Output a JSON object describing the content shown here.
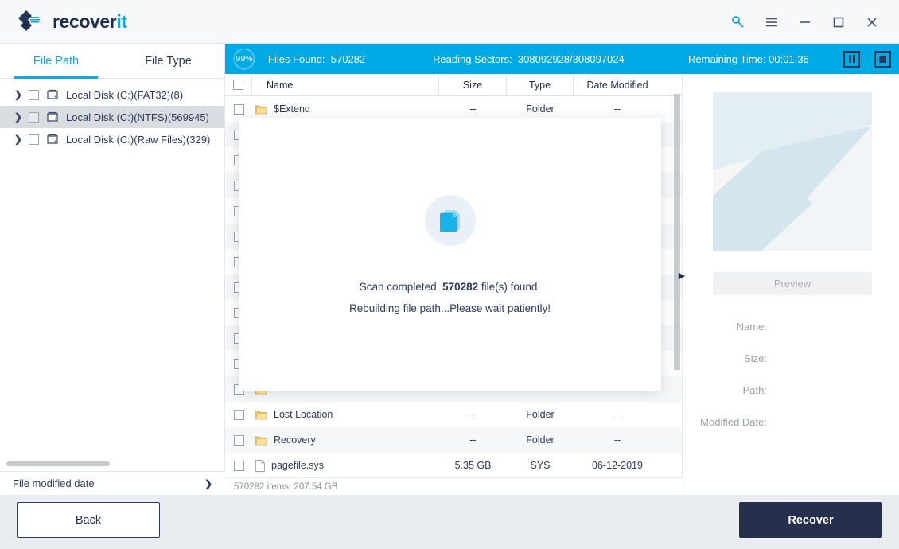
{
  "app": {
    "brand_main": "recover",
    "brand_accent": "it",
    "accent_color": "#13a7e0",
    "navy_color": "#26304d",
    "progress_bg": "#00aae4"
  },
  "titlebar": {
    "icons": [
      "key-icon",
      "menu-icon",
      "minimize-icon",
      "maximize-icon",
      "close-icon"
    ]
  },
  "sidebar": {
    "tabs": [
      {
        "label": "File Path",
        "active": true
      },
      {
        "label": "File Type",
        "active": false
      }
    ],
    "tree": [
      {
        "label": "Local Disk (C:)(FAT32)(8)",
        "selected": false
      },
      {
        "label": "Local Disk (C:)(NTFS)(569945)",
        "selected": true
      },
      {
        "label": "Local Disk (C:)(Raw Files)(329)",
        "selected": false
      }
    ],
    "filter_label": "File modified date",
    "filter_arrow": "❯"
  },
  "progress": {
    "percent_label": "99%",
    "percent_value": 99,
    "files_found_label": "Files Found:",
    "files_found_value": "570282",
    "reading_sectors_label": "Reading Sectors:",
    "reading_sectors_value": "308092928/308097024",
    "remaining_time_label": "Remaining Time:",
    "remaining_time_value": "00:01:36",
    "pause_label": "pause-button",
    "stop_label": "stop-button"
  },
  "filelist": {
    "columns": [
      "Name",
      "Size",
      "Type",
      "Date Modified"
    ],
    "rows": [
      {
        "name": "$Extend",
        "size": "--",
        "type": "Folder",
        "date": "--",
        "icon": "folder"
      },
      {
        "name": "",
        "size": "",
        "type": "",
        "date": "",
        "icon": "folder"
      },
      {
        "name": "",
        "size": "",
        "type": "",
        "date": "",
        "icon": "folder"
      },
      {
        "name": "",
        "size": "",
        "type": "",
        "date": "",
        "icon": "folder"
      },
      {
        "name": "",
        "size": "",
        "type": "",
        "date": "",
        "icon": "folder"
      },
      {
        "name": "",
        "size": "",
        "type": "",
        "date": "",
        "icon": "folder"
      },
      {
        "name": "",
        "size": "",
        "type": "",
        "date": "",
        "icon": "folder"
      },
      {
        "name": "",
        "size": "",
        "type": "",
        "date": "",
        "icon": "folder"
      },
      {
        "name": "",
        "size": "",
        "type": "",
        "date": "",
        "icon": "folder"
      },
      {
        "name": "",
        "size": "",
        "type": "",
        "date": "",
        "icon": "folder"
      },
      {
        "name": "",
        "size": "",
        "type": "",
        "date": "",
        "icon": "folder"
      },
      {
        "name": "",
        "size": "",
        "type": "",
        "date": "",
        "icon": "folder"
      },
      {
        "name": "Lost Location",
        "size": "--",
        "type": "Folder",
        "date": "--",
        "icon": "folder"
      },
      {
        "name": "Recovery",
        "size": "--",
        "type": "Folder",
        "date": "--",
        "icon": "folder"
      },
      {
        "name": "pagefile.sys",
        "size": "5.35  GB",
        "type": "SYS",
        "date": "06-12-2019",
        "icon": "file"
      }
    ],
    "status_text": "570282 items, 207.54  GB",
    "view_grid": "grid-view-icon",
    "view_list": "list-view-icon"
  },
  "preview": {
    "button_label": "Preview",
    "fields": [
      {
        "label": "Name:",
        "value": ""
      },
      {
        "label": "Size:",
        "value": ""
      },
      {
        "label": "Path:",
        "value": ""
      },
      {
        "label": "Modified Date:",
        "value": ""
      }
    ]
  },
  "modal": {
    "icon": "documents-stack-icon",
    "line1_prefix": "Scan completed, ",
    "line1_count": "570282",
    "line1_suffix": " file(s) found.",
    "line2": "Rebuilding file path...Please wait patiently!"
  },
  "footer": {
    "back_label": "Back",
    "recover_label": "Recover"
  }
}
